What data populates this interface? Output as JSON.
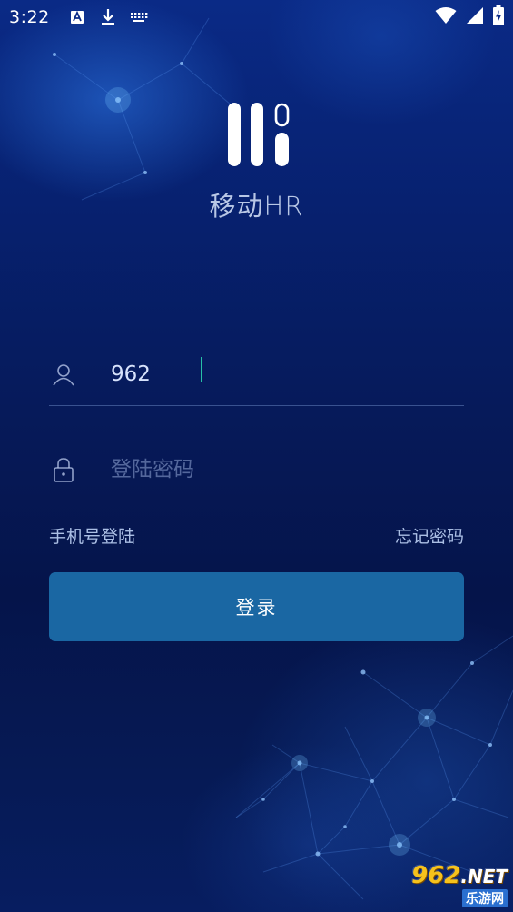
{
  "status_bar": {
    "time": "3:22",
    "icons": [
      "text-a-icon",
      "download-icon",
      "keyboard-icon",
      "wifi-icon",
      "signal-icon",
      "battery-charging-icon"
    ]
  },
  "app": {
    "name": "移动HR",
    "logo_icon": "app-logo-icon"
  },
  "login_form": {
    "username": {
      "value": "962",
      "icon": "user-icon"
    },
    "password": {
      "value": "",
      "placeholder": "登陆密码",
      "icon": "lock-icon"
    },
    "phone_login_label": "手机号登陆",
    "forgot_password_label": "忘记密码",
    "submit_label": "登录"
  },
  "watermark": {
    "main": "962",
    "suffix": ".NET",
    "sub": "乐游网"
  },
  "colors": {
    "button": "#1a67a3",
    "caret": "#27c0a6",
    "watermark": "#f6c21c"
  }
}
